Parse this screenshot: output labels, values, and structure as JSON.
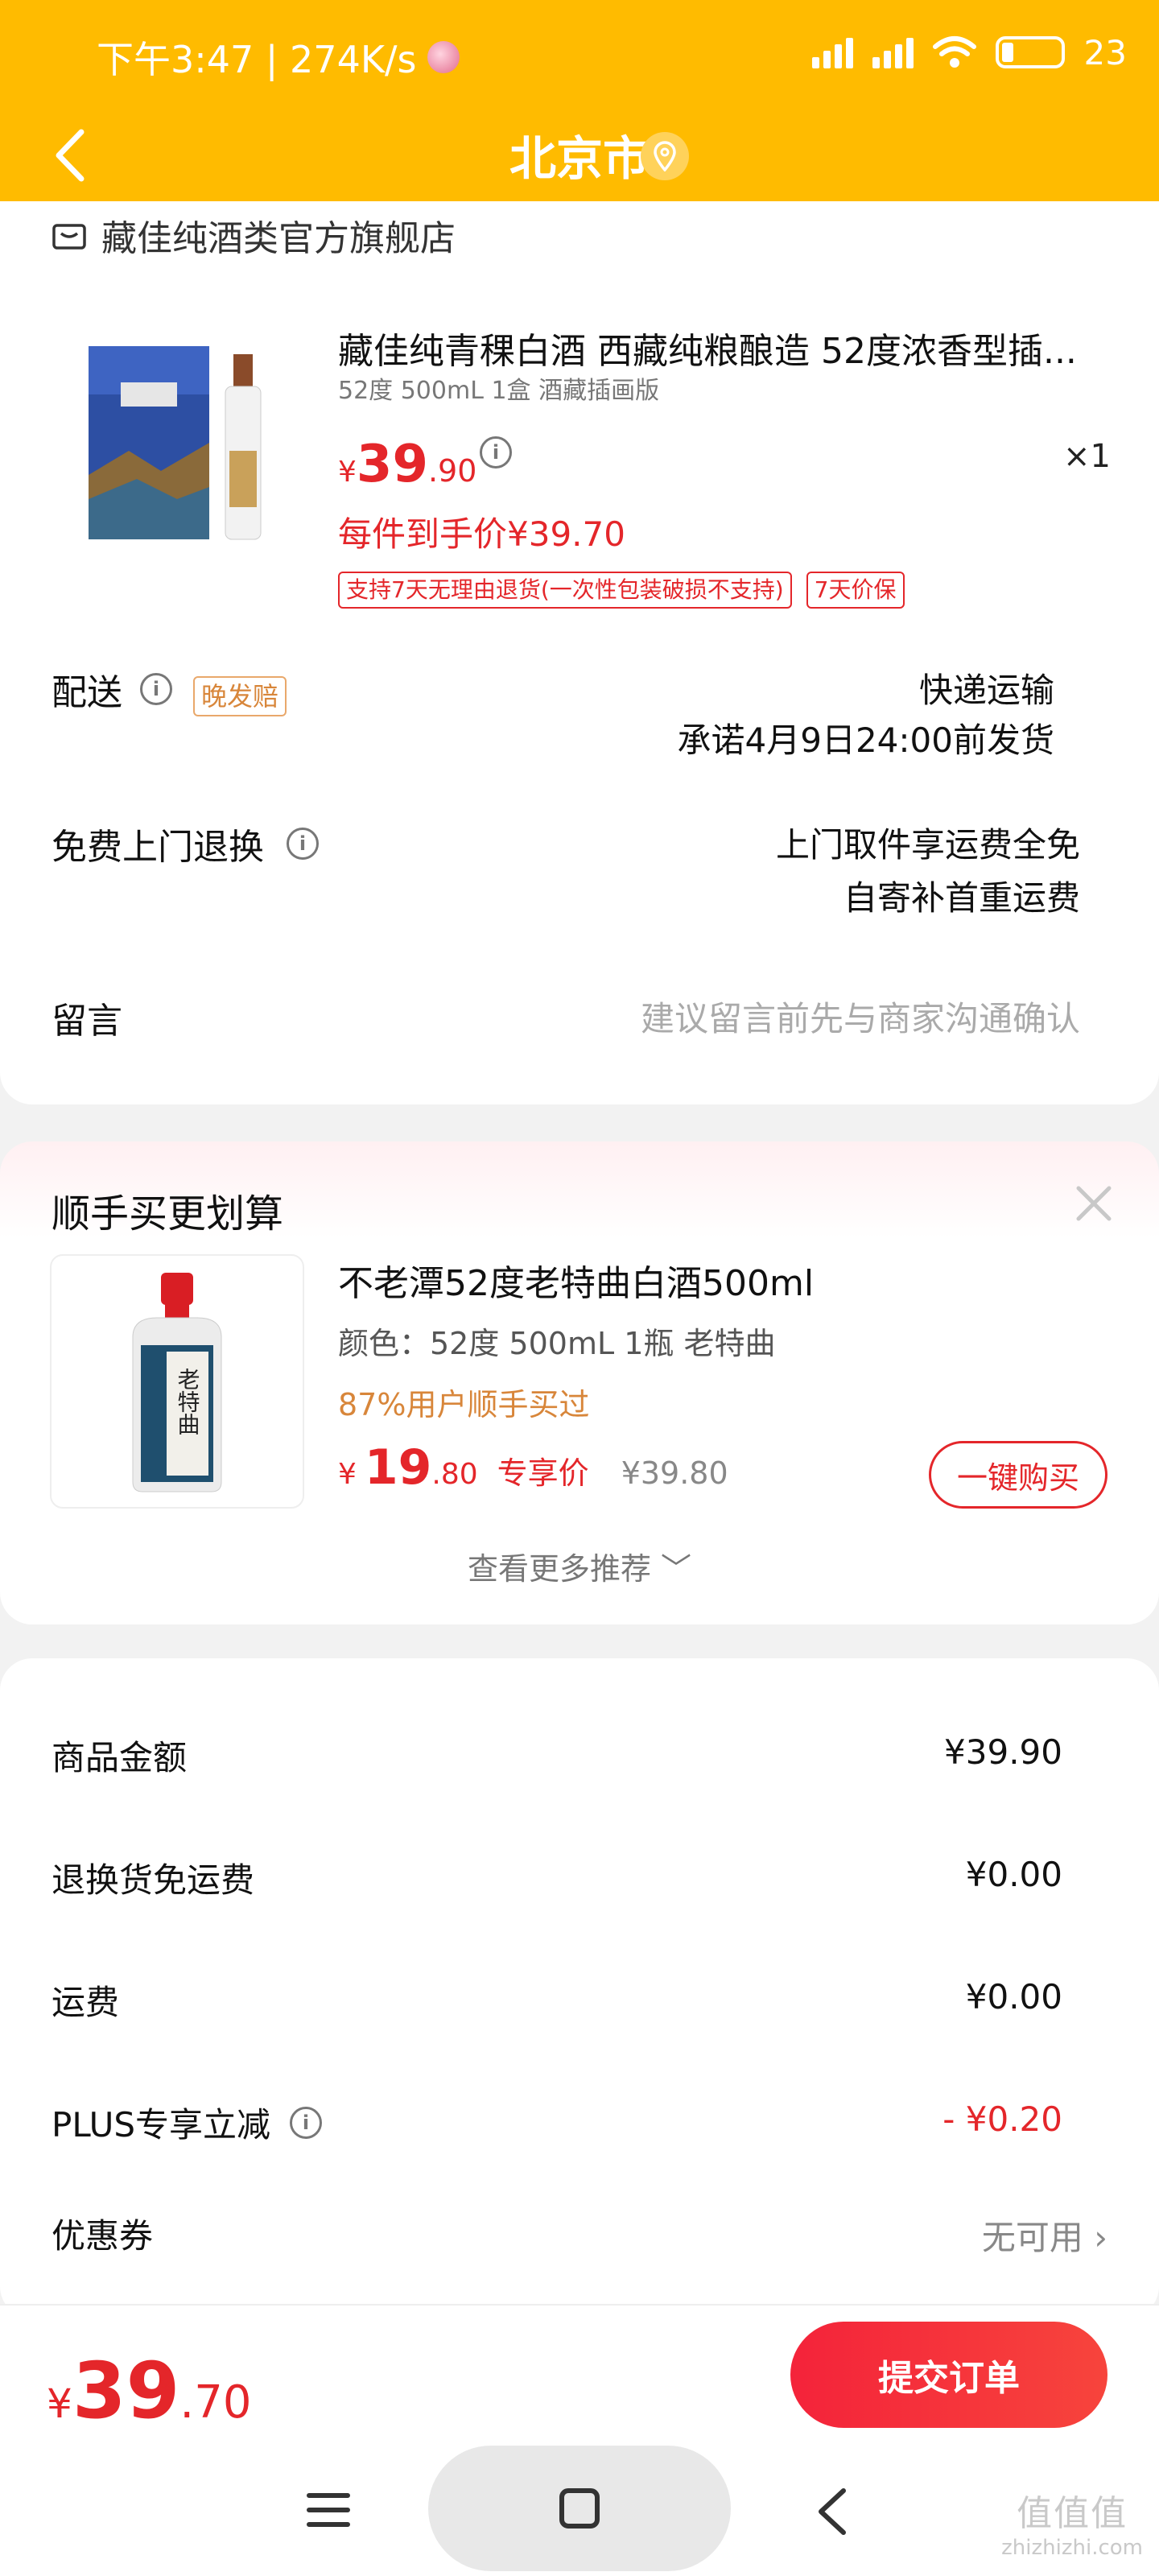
{
  "status_bar": {
    "time_speed": "下午3:47 | 274K/s",
    "battery": "23"
  },
  "header": {
    "title": "北京市"
  },
  "store": {
    "name": "藏佳纯酒类官方旗舰店"
  },
  "product": {
    "title": "藏佳纯青稞白酒 西藏纯粮酿造 52度浓香型插...",
    "spec": "52度 500mL 1盒 酒藏插画版",
    "price_currency": "¥",
    "price_int": "39",
    "price_dec": ".90",
    "quantity": "×1",
    "unit_price": "每件到手价¥39.70",
    "tags": [
      "支持7天无理由退货(一次性包装破损不支持)",
      "7天价保"
    ]
  },
  "delivery": {
    "label": "配送",
    "late_tag": "晚发赔",
    "method": "快递运输",
    "promise": "承诺4月9日24:00前发货"
  },
  "return": {
    "label": "免费上门退换",
    "line1": "上门取件享运费全免",
    "line2": "自寄补首重运费"
  },
  "message": {
    "label": "留言",
    "placeholder": "建议留言前先与商家沟通确认"
  },
  "recommend": {
    "title": "顺手买更划算",
    "item_title": "不老潭52度老特曲白酒500ml",
    "item_spec": "颜色：52度 500mL 1瓶 老特曲",
    "social": "87%用户顺手买过",
    "price_currency": "¥",
    "price_int": "19",
    "price_dec": ".80",
    "price_label": "专享价",
    "orig_price": "¥39.80",
    "buy_label": "一键购买",
    "more_label": "查看更多推荐 ﹀",
    "bottle_label": "老特曲"
  },
  "totals": {
    "rows": [
      {
        "label": "商品金额",
        "value": "¥39.90"
      },
      {
        "label": "退换货免运费",
        "value": "¥0.00"
      },
      {
        "label": "运费",
        "value": "¥0.00"
      },
      {
        "label": "PLUS专享立减",
        "value": "- ¥0.20"
      },
      {
        "label": "优惠券",
        "value": "无可用 ›"
      }
    ]
  },
  "bottom": {
    "currency": "¥",
    "total_int": "39",
    "total_dec": ".70",
    "submit_label": "提交订单"
  },
  "colors": {
    "header_bg": "#ffbb00",
    "accent_red": "#e4262a",
    "orange_text": "#d8863a"
  },
  "watermark": {
    "main": "值值值",
    "sub": "zhizhizhi.com"
  }
}
